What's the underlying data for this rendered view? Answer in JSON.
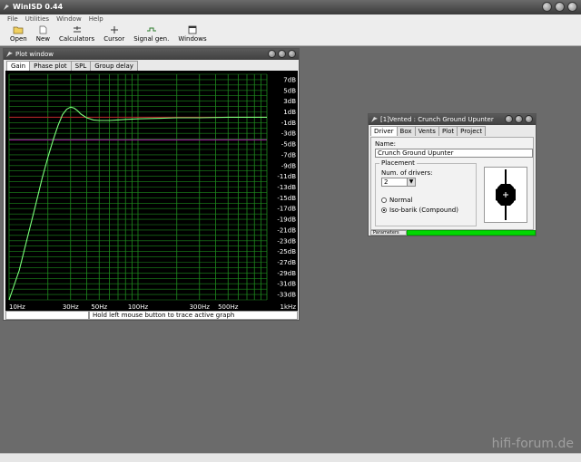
{
  "app": {
    "title": "WinISD 0.44"
  },
  "menu": [
    "File",
    "Utilities",
    "Window",
    "Help"
  ],
  "toolbar": [
    "Open",
    "New",
    "Calculators",
    "Cursor",
    "Signal gen.",
    "Windows"
  ],
  "plot_window": {
    "title": "Plot window",
    "tabs": [
      "Gain",
      "Phase plot",
      "SPL",
      "Group delay"
    ],
    "active_tab": "Gain",
    "status_hint": "Hold left mouse button to trace active graph"
  },
  "project_window": {
    "title": "[1]Vented : Crunch Ground Upunter",
    "tabs": [
      "Driver",
      "Box",
      "Vents",
      "Plot",
      "Project"
    ],
    "active_tab": "Driver",
    "name_label": "Name:",
    "name_value": "Crunch Ground Upunter",
    "placement_legend": "Placement",
    "num_drivers_label": "Num. of drivers:",
    "num_drivers_value": "2",
    "placement_options": [
      "Normal",
      "Iso-barik (Compound)"
    ],
    "placement_selected": "Iso-barik (Compound)",
    "progress_label": "Parameters"
  },
  "chart_data": {
    "type": "line",
    "title": "",
    "xlabel": "",
    "ylabel": "",
    "x_scale": "log",
    "xlim": [
      10,
      1000
    ],
    "ylim": [
      -34,
      8
    ],
    "x_tick_labels": [
      "10Hz",
      "30Hz",
      "50Hz",
      "100Hz",
      "300Hz",
      "500Hz",
      "1kHz"
    ],
    "x_tick_values": [
      10,
      30,
      50,
      100,
      300,
      500,
      1000
    ],
    "y_tick_labels": [
      "7dB",
      "5dB",
      "3dB",
      "1dB",
      "-1dB",
      "-3dB",
      "-5dB",
      "-7dB",
      "-9dB",
      "-11dB",
      "-13dB",
      "-15dB",
      "-17dB",
      "-19dB",
      "-21dB",
      "-23dB",
      "-25dB",
      "-27dB",
      "-29dB",
      "-31dB",
      "-33dB"
    ],
    "y_tick_values": [
      7,
      5,
      3,
      1,
      -1,
      -3,
      -5,
      -7,
      -9,
      -11,
      -13,
      -15,
      -17,
      -19,
      -21,
      -23,
      -25,
      -27,
      -29,
      -31,
      -33
    ],
    "grid": true,
    "reference_lines": [
      {
        "y": 0,
        "color": "#c0202a"
      },
      {
        "y": -4.2,
        "color": "#b020b0"
      }
    ],
    "series": [
      {
        "color": "#7cff7c",
        "x": [
          10,
          12,
          14,
          16,
          18,
          20,
          22,
          24,
          26,
          28,
          30,
          32,
          34,
          36,
          40,
          45,
          50,
          60,
          70,
          80,
          100,
          150,
          200,
          300,
          500,
          1000
        ],
        "y": [
          -34,
          -28.5,
          -22,
          -16.5,
          -11.5,
          -7.5,
          -4.2,
          -1.5,
          0.5,
          1.5,
          1.9,
          1.7,
          1.2,
          0.6,
          -0.1,
          -0.5,
          -0.6,
          -0.6,
          -0.5,
          -0.4,
          -0.3,
          -0.2,
          -0.1,
          -0.1,
          0,
          0
        ]
      }
    ],
    "colors": {
      "background": "#000000",
      "grid": "#1e8a1e"
    }
  }
}
